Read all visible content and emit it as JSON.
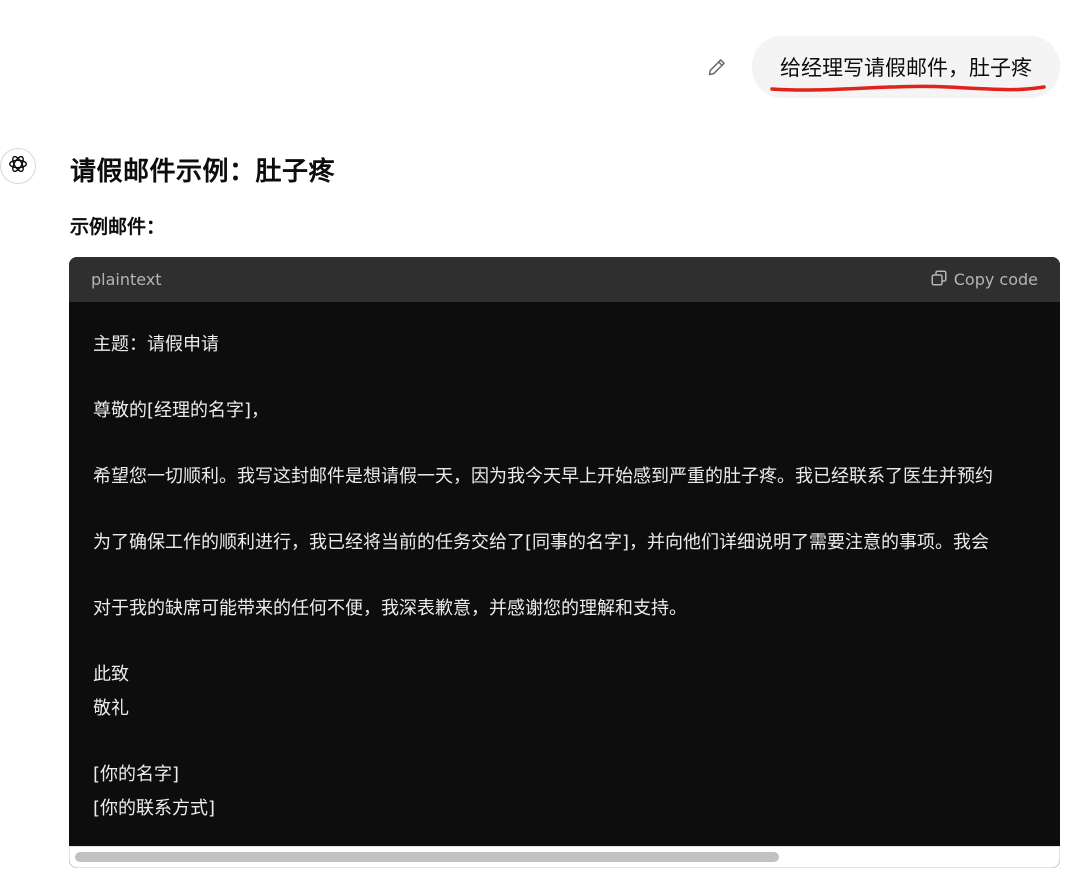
{
  "user_message": {
    "text": "给经理写请假邮件，肚子疼",
    "edit_icon": "pencil-icon"
  },
  "assistant": {
    "avatar_icon": "openai-logo-icon",
    "title": "请假邮件示例：肚子疼",
    "subtitle": "示例邮件："
  },
  "code_block": {
    "language": "plaintext",
    "copy_label": "Copy code",
    "copy_icon": "copy-icon",
    "lines": [
      "主题：请假申请",
      "",
      "尊敬的[经理的名字]，",
      "",
      "希望您一切顺利。我写这封邮件是想请假一天，因为我今天早上开始感到严重的肚子疼。我已经联系了医生并预约",
      "",
      "为了确保工作的顺利进行，我已经将当前的任务交给了[同事的名字]，并向他们详细说明了需要注意的事项。我会",
      "",
      "对于我的缺席可能带来的任何不便，我深表歉意，并感谢您的理解和支持。",
      "",
      "此致",
      "敬礼",
      "",
      "[你的名字]",
      "[你的联系方式]"
    ]
  },
  "colors": {
    "code_bg": "#0d0d0d",
    "code_header_bg": "#2f2f2f",
    "user_bubble_bg": "#f4f4f4",
    "annotation_underline": "#e0231b"
  }
}
